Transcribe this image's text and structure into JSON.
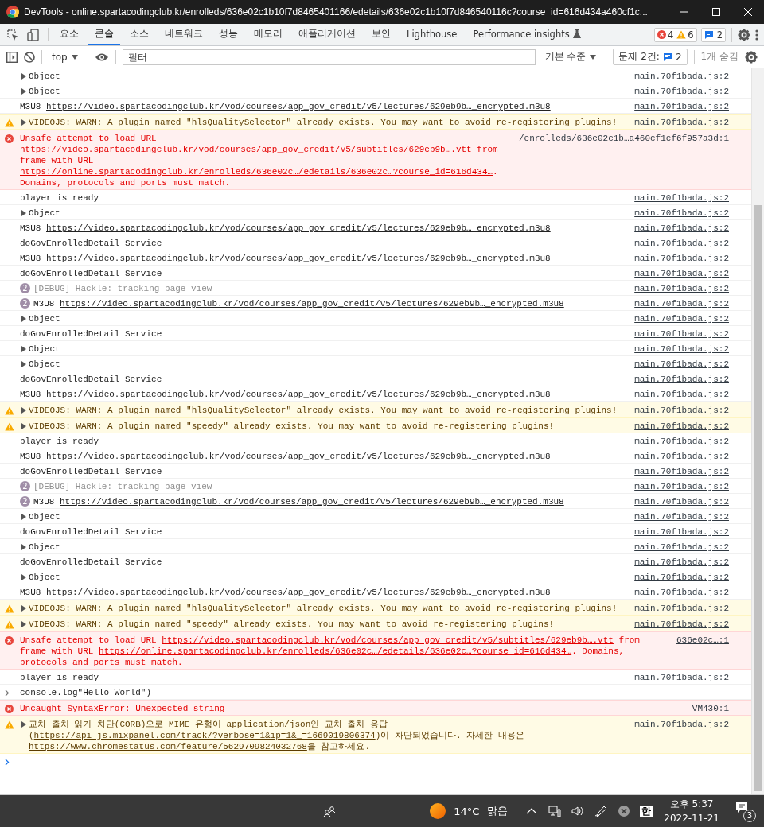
{
  "window": {
    "title": "DevTools - online.spartacodingclub.kr/enrolleds/636e02c1b10f7d8465401166/edetails/636e02c1b10f7d846540116c?course_id=616d434a460cf1c..."
  },
  "tabs": [
    {
      "label": "요소",
      "selected": false
    },
    {
      "label": "콘솔",
      "selected": true
    },
    {
      "label": "소스",
      "selected": false
    },
    {
      "label": "네트워크",
      "selected": false
    },
    {
      "label": "성능",
      "selected": false
    },
    {
      "label": "메모리",
      "selected": false
    },
    {
      "label": "애플리케이션",
      "selected": false
    },
    {
      "label": "보안",
      "selected": false
    },
    {
      "label": "Lighthouse",
      "selected": false
    },
    {
      "label": "Performance insights",
      "selected": false
    }
  ],
  "counters": {
    "errors": "4",
    "warnings": "6",
    "issues": "2"
  },
  "toolbar": {
    "context": "top",
    "filter_placeholder": "필터",
    "level": "기본 수준",
    "issues_label": "문제 2건:",
    "issues_count": "2",
    "hidden": "1개 숨김"
  },
  "messages": [
    {
      "kind": "log",
      "expandable": true,
      "parts": [
        {
          "kind": "text",
          "text": "Object"
        }
      ],
      "source": "main.70f1bada.js:2"
    },
    {
      "kind": "log",
      "expandable": true,
      "parts": [
        {
          "kind": "text",
          "text": "Object"
        }
      ],
      "source": "main.70f1bada.js:2"
    },
    {
      "kind": "log",
      "parts": [
        {
          "kind": "text",
          "text": "M3U8 "
        },
        {
          "kind": "link",
          "text": "https://video.spartacodingclub.kr/vod/courses/app_gov_credit/v5/lectures/629eb9b…_encrypted.m3u8"
        }
      ],
      "source": "main.70f1bada.js:2"
    },
    {
      "kind": "warn",
      "expandable": true,
      "parts": [
        {
          "kind": "text",
          "text": "VIDEOJS: WARN: A plugin named \"hlsQualitySelector\" already exists. You may want to avoid re-registering plugins!"
        }
      ],
      "source": "main.70f1bada.js:2"
    },
    {
      "kind": "error",
      "parts": [
        {
          "kind": "text",
          "text": "Unsafe attempt to load URL "
        },
        {
          "kind": "link",
          "text": "https://video.spartacodingclub.kr/vod/courses/app_gov_credit/v5/subtitles/629eb9b….vtt"
        },
        {
          "kind": "text",
          "text": " from frame with URL "
        },
        {
          "kind": "link",
          "text": "https://online.spartacodingclub.kr/enrolleds/636e02c…/edetails/636e02c…?course_id=616d434…"
        },
        {
          "kind": "text",
          "text": ". Domains, protocols and ports must match."
        }
      ],
      "source": "/enrolleds/636e02c1b…a460cf1cf6f957a3d:1"
    },
    {
      "kind": "log",
      "parts": [
        {
          "kind": "text",
          "text": "player is ready"
        }
      ],
      "source": "main.70f1bada.js:2"
    },
    {
      "kind": "log",
      "expandable": true,
      "parts": [
        {
          "kind": "text",
          "text": "Object"
        }
      ],
      "source": "main.70f1bada.js:2"
    },
    {
      "kind": "log",
      "parts": [
        {
          "kind": "text",
          "text": "M3U8 "
        },
        {
          "kind": "link",
          "text": "https://video.spartacodingclub.kr/vod/courses/app_gov_credit/v5/lectures/629eb9b…_encrypted.m3u8"
        }
      ],
      "source": "main.70f1bada.js:2"
    },
    {
      "kind": "log",
      "parts": [
        {
          "kind": "text",
          "text": "doGovEnrolledDetail Service"
        }
      ],
      "source": "main.70f1bada.js:2"
    },
    {
      "kind": "log",
      "parts": [
        {
          "kind": "text",
          "text": "M3U8 "
        },
        {
          "kind": "link",
          "text": "https://video.spartacodingclub.kr/vod/courses/app_gov_credit/v5/lectures/629eb9b…_encrypted.m3u8"
        }
      ],
      "source": "main.70f1bada.js:2"
    },
    {
      "kind": "log",
      "parts": [
        {
          "kind": "text",
          "text": "doGovEnrolledDetail Service"
        }
      ],
      "source": "main.70f1bada.js:2"
    },
    {
      "kind": "debug",
      "count": "2",
      "parts": [
        {
          "kind": "text",
          "text": "[DEBUG] Hackle: tracking page view"
        }
      ],
      "source": "main.70f1bada.js:2"
    },
    {
      "kind": "log",
      "count": "2",
      "parts": [
        {
          "kind": "text",
          "text": "M3U8 "
        },
        {
          "kind": "link",
          "text": "https://video.spartacodingclub.kr/vod/courses/app_gov_credit/v5/lectures/629eb9b…_encrypted.m3u8"
        }
      ],
      "source": "main.70f1bada.js:2"
    },
    {
      "kind": "log",
      "expandable": true,
      "parts": [
        {
          "kind": "text",
          "text": "Object"
        }
      ],
      "source": "main.70f1bada.js:2"
    },
    {
      "kind": "log",
      "parts": [
        {
          "kind": "text",
          "text": "doGovEnrolledDetail Service"
        }
      ],
      "source": "main.70f1bada.js:2"
    },
    {
      "kind": "log",
      "expandable": true,
      "parts": [
        {
          "kind": "text",
          "text": "Object"
        }
      ],
      "source": "main.70f1bada.js:2"
    },
    {
      "kind": "log",
      "expandable": true,
      "parts": [
        {
          "kind": "text",
          "text": "Object"
        }
      ],
      "source": "main.70f1bada.js:2"
    },
    {
      "kind": "log",
      "parts": [
        {
          "kind": "text",
          "text": "doGovEnrolledDetail Service"
        }
      ],
      "source": "main.70f1bada.js:2"
    },
    {
      "kind": "log",
      "parts": [
        {
          "kind": "text",
          "text": "M3U8 "
        },
        {
          "kind": "link",
          "text": "https://video.spartacodingclub.kr/vod/courses/app_gov_credit/v5/lectures/629eb9b…_encrypted.m3u8"
        }
      ],
      "source": "main.70f1bada.js:2"
    },
    {
      "kind": "warn",
      "expandable": true,
      "parts": [
        {
          "kind": "text",
          "text": "VIDEOJS: WARN: A plugin named \"hlsQualitySelector\" already exists. You may want to avoid re-registering plugins!"
        }
      ],
      "source": "main.70f1bada.js:2"
    },
    {
      "kind": "warn",
      "expandable": true,
      "parts": [
        {
          "kind": "text",
          "text": "VIDEOJS: WARN: A plugin named \"speedy\" already exists. You may want to avoid re-registering plugins!"
        }
      ],
      "source": "main.70f1bada.js:2"
    },
    {
      "kind": "log",
      "parts": [
        {
          "kind": "text",
          "text": "player is ready"
        }
      ],
      "source": "main.70f1bada.js:2"
    },
    {
      "kind": "log",
      "parts": [
        {
          "kind": "text",
          "text": "M3U8 "
        },
        {
          "kind": "link",
          "text": "https://video.spartacodingclub.kr/vod/courses/app_gov_credit/v5/lectures/629eb9b…_encrypted.m3u8"
        }
      ],
      "source": "main.70f1bada.js:2"
    },
    {
      "kind": "log",
      "parts": [
        {
          "kind": "text",
          "text": "doGovEnrolledDetail Service"
        }
      ],
      "source": "main.70f1bada.js:2"
    },
    {
      "kind": "debug",
      "count": "2",
      "parts": [
        {
          "kind": "text",
          "text": "[DEBUG] Hackle: tracking page view"
        }
      ],
      "source": "main.70f1bada.js:2"
    },
    {
      "kind": "log",
      "count": "2",
      "parts": [
        {
          "kind": "text",
          "text": "M3U8 "
        },
        {
          "kind": "link",
          "text": "https://video.spartacodingclub.kr/vod/courses/app_gov_credit/v5/lectures/629eb9b…_encrypted.m3u8"
        }
      ],
      "source": "main.70f1bada.js:2"
    },
    {
      "kind": "log",
      "expandable": true,
      "parts": [
        {
          "kind": "text",
          "text": "Object"
        }
      ],
      "source": "main.70f1bada.js:2"
    },
    {
      "kind": "log",
      "parts": [
        {
          "kind": "text",
          "text": "doGovEnrolledDetail Service"
        }
      ],
      "source": "main.70f1bada.js:2"
    },
    {
      "kind": "log",
      "expandable": true,
      "parts": [
        {
          "kind": "text",
          "text": "Object"
        }
      ],
      "source": "main.70f1bada.js:2"
    },
    {
      "kind": "log",
      "parts": [
        {
          "kind": "text",
          "text": "doGovEnrolledDetail Service"
        }
      ],
      "source": "main.70f1bada.js:2"
    },
    {
      "kind": "log",
      "expandable": true,
      "parts": [
        {
          "kind": "text",
          "text": "Object"
        }
      ],
      "source": "main.70f1bada.js:2"
    },
    {
      "kind": "log",
      "parts": [
        {
          "kind": "text",
          "text": "M3U8 "
        },
        {
          "kind": "link",
          "text": "https://video.spartacodingclub.kr/vod/courses/app_gov_credit/v5/lectures/629eb9b…_encrypted.m3u8"
        }
      ],
      "source": "main.70f1bada.js:2"
    },
    {
      "kind": "warn",
      "expandable": true,
      "parts": [
        {
          "kind": "text",
          "text": "VIDEOJS: WARN: A plugin named \"hlsQualitySelector\" already exists. You may want to avoid re-registering plugins!"
        }
      ],
      "source": "main.70f1bada.js:2"
    },
    {
      "kind": "warn",
      "expandable": true,
      "parts": [
        {
          "kind": "text",
          "text": "VIDEOJS: WARN: A plugin named \"speedy\" already exists. You may want to avoid re-registering plugins!"
        }
      ],
      "source": "main.70f1bada.js:2"
    },
    {
      "kind": "error",
      "parts": [
        {
          "kind": "text",
          "text": "Unsafe attempt to load URL "
        },
        {
          "kind": "link",
          "text": "https://video.spartacodingclub.kr/vod/courses/app_gov_credit/v5/subtitles/629eb9b….vtt"
        },
        {
          "kind": "text",
          "text": " from frame with URL "
        },
        {
          "kind": "link",
          "text": "https://online.spartacodingclub.kr/enrolleds/636e02c…/edetails/636e02c…?course_id=616d434…"
        },
        {
          "kind": "text",
          "text": ". Domains, protocols and ports must match."
        }
      ],
      "source": "636e02c…:1"
    },
    {
      "kind": "log",
      "parts": [
        {
          "kind": "text",
          "text": "player is ready"
        }
      ],
      "source": "main.70f1bada.js:2"
    },
    {
      "kind": "input",
      "parts": [
        {
          "kind": "text",
          "text": "console.log\"Hello World\")"
        }
      ]
    },
    {
      "kind": "error",
      "parts": [
        {
          "kind": "text",
          "text": "Uncaught SyntaxError: Unexpected string"
        }
      ],
      "source": "VM430:1"
    },
    {
      "kind": "warn",
      "expandable": true,
      "parts": [
        {
          "kind": "text",
          "text": "교차 출처 읽기 차단(CORB)으로 MIME 유형이 application/json인 교차 출처 응답("
        },
        {
          "kind": "link",
          "text": "https://api-js.mixpanel.com/track/?verbose=1&ip=1&_=1669019806374"
        },
        {
          "kind": "text",
          "text": ")이 차단되었습니다. 자세한 내용은 "
        },
        {
          "kind": "link",
          "text": "https://www.chromestatus.com/feature/5629709824032768"
        },
        {
          "kind": "text",
          "text": "을 참고하세요."
        }
      ],
      "source": "main.70f1bada.js:2"
    },
    {
      "kind": "prompt"
    }
  ],
  "taskbar": {
    "temperature": "14°C",
    "weather": "맑음",
    "ime": "한",
    "time": "오후 5:37",
    "date": "2022-11-21",
    "notifications": "3"
  }
}
